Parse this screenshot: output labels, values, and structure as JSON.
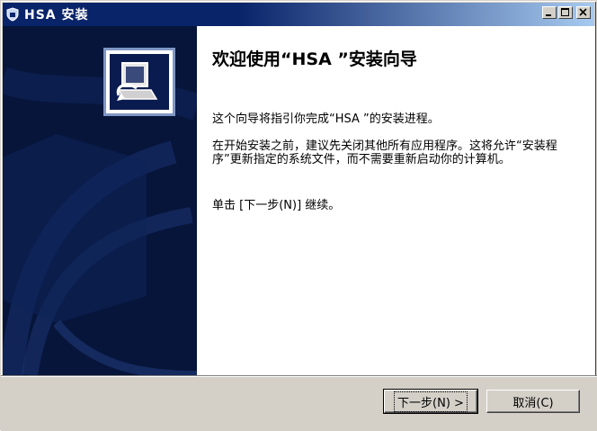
{
  "window": {
    "title": "HSA  安装",
    "controls": [
      "minimize",
      "maximize",
      "close"
    ]
  },
  "sidebar": {
    "logo_icon": "installer-computer-icon"
  },
  "main": {
    "heading": "欢迎使用“HSA ”安装向导",
    "paragraph1": "这个向导将指引你完成“HSA ”的安装进程。",
    "paragraph2": "在开始安装之前，建议先关闭其他所有应用程序。这将允许“安装程序”更新指定的系统文件，而不需要重新启动你的计算机。",
    "paragraph3": "单击 [下一步(N)] 继续。"
  },
  "buttons": {
    "next_label": "下一步(N) >",
    "cancel_label": "取消(C)"
  },
  "colors": {
    "titlebar_start": "#0a246a",
    "titlebar_end": "#a6caf0",
    "sidebar_bg": "#07153b",
    "window_bg": "#d4d0c8"
  }
}
